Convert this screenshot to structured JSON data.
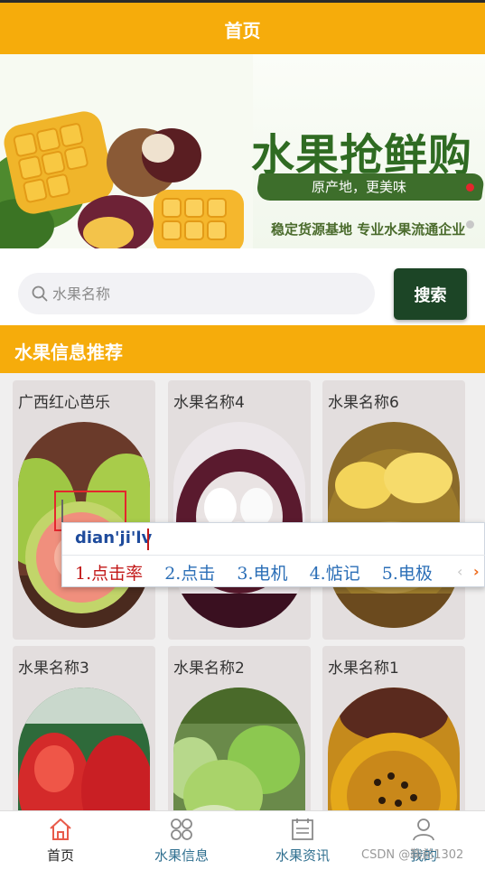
{
  "header": {
    "title": "首页"
  },
  "banner": {
    "headline": "水果抢鲜购",
    "subhead": "原产地，更美味",
    "tagline": "稳定货源基地  专业水果流通企业"
  },
  "search": {
    "placeholder": "水果名称",
    "value": "",
    "button_label": "搜索"
  },
  "section": {
    "title": "水果信息推荐"
  },
  "fruits": [
    {
      "name": "广西红心芭乐",
      "image": "red-guava-photo"
    },
    {
      "name": "水果名称4",
      "image": "mangosteen-photo"
    },
    {
      "name": "水果名称6",
      "image": "durian-photo"
    },
    {
      "name": "水果名称3",
      "image": "wax-apple-photo"
    },
    {
      "name": "水果名称2",
      "image": "green-apple-photo"
    },
    {
      "name": "水果名称1",
      "image": "passion-fruit-photo"
    }
  ],
  "ime": {
    "composition": "dian'ji'lv",
    "candidates": [
      "1.点击率",
      "2.点击",
      "3.电机",
      "4.惦记",
      "5.电极"
    ],
    "selected_index": 0
  },
  "tabs": [
    {
      "label": "首页",
      "icon": "home-icon",
      "active": true
    },
    {
      "label": "水果信息",
      "icon": "grid-icon",
      "active": false
    },
    {
      "label": "水果资讯",
      "icon": "news-icon",
      "active": false
    },
    {
      "label": "我的",
      "icon": "user-icon",
      "active": false
    }
  ],
  "watermark": "CSDN @鞠前1302",
  "colors": {
    "primary": "#f6ac0b",
    "search_button": "#1c4526",
    "banner_green": "#2f6b22",
    "ime_selected": "#c21818",
    "ime_candidate": "#2c6fb7"
  }
}
